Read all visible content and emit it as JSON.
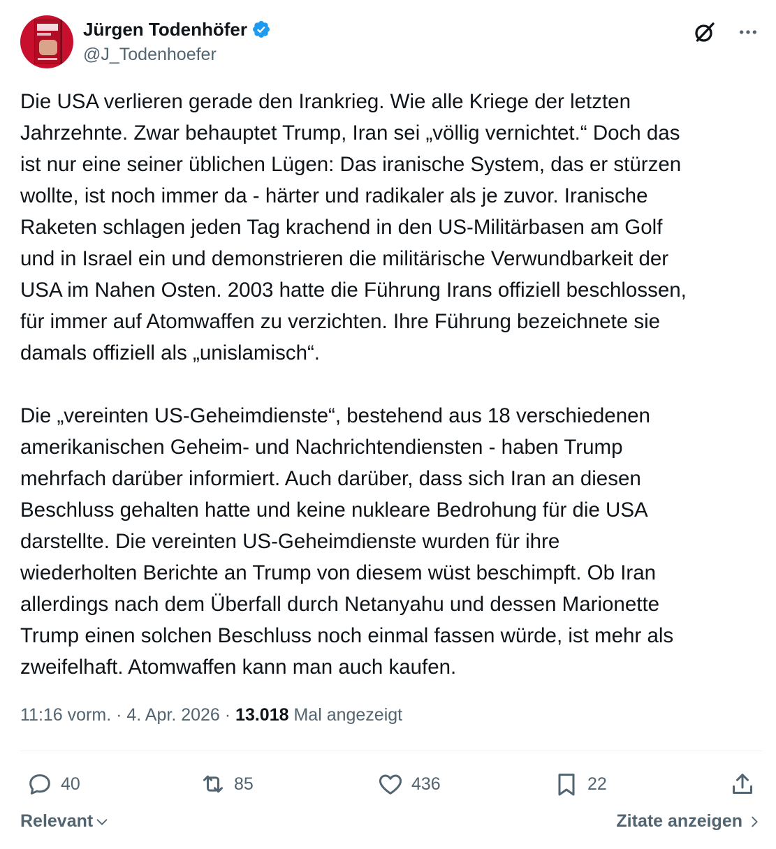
{
  "author": {
    "display_name": "Jürgen Todenhöfer",
    "handle": "@J_Todenhoefer",
    "verified": true,
    "avatar_icon": "book-cover-avatar"
  },
  "header_actions": {
    "grok_icon": "grok-icon",
    "more_icon": "more-icon"
  },
  "tweet": {
    "text": "Die USA verlieren gerade den Irankrieg. Wie alle Kriege der letzten\nJahrzehnte. Zwar behauptet Trump, Iran sei „völlig vernichtet.“ Doch das\nist nur eine seiner üblichen Lügen: Das iranische System, das er stürzen\nwollte, ist noch immer da - härter und radikaler als je zuvor. Iranische\nRaketen schlagen jeden Tag krachend in den US-Militärbasen am Golf\nund in Israel ein und demonstrieren die militärische Verwundbarkeit der\nUSA im Nahen Osten. 2003 hatte die Führung Irans offiziell beschlossen,\nfür immer auf Atomwaffen zu verzichten. Ihre Führung bezeichnete sie\ndamals offiziell als „unislamisch“.\n\nDie „vereinten US-Geheimdienste“, bestehend aus 18 verschiedenen\namerikanischen Geheim- und Nachrichtendiensten - haben Trump\nmehrfach darüber informiert. Auch darüber, dass sich Iran an diesen\nBeschluss gehalten hatte und keine nukleare Bedrohung für die USA\ndarstellte. Die vereinten US-Geheimdienste wurden für ihre\nwiederholten Berichte an Trump von diesem wüst beschimpft. Ob Iran\nallerdings nach dem Überfall durch Netanyahu und dessen Marionette\nTrump einen solchen Beschluss noch einmal fassen würde, ist mehr als\nzweifelhaft. Atomwaffen kann man auch kaufen."
  },
  "meta": {
    "time": "11:16 vorm.",
    "sep1": " · ",
    "date": "4. Apr. 2026",
    "sep2": " · ",
    "views_count": "13.018",
    "views_label": " Mal angezeigt"
  },
  "actions": {
    "replies": "40",
    "reposts": "85",
    "likes": "436",
    "bookmarks": "22"
  },
  "footer": {
    "sort_label": "Relevant",
    "quotes_label": "Zitate anzeigen"
  },
  "colors": {
    "verified": "#1d9bf0",
    "text": "#0f1419",
    "secondary": "#536471"
  }
}
